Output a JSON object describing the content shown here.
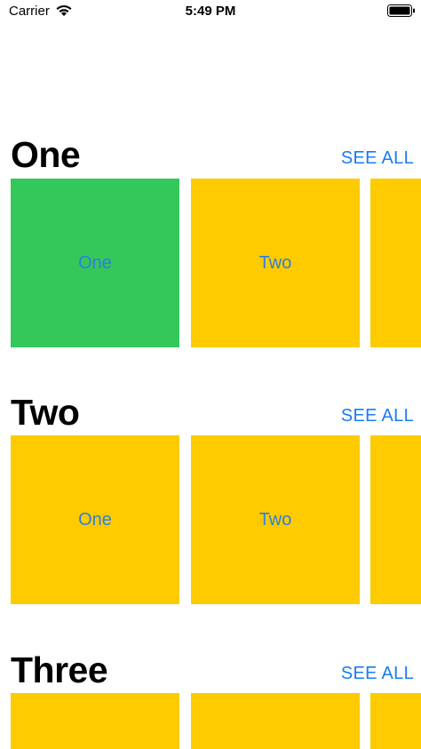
{
  "status_bar": {
    "carrier": "Carrier",
    "time": "5:49 PM",
    "icons": [
      "wifi-icon",
      "battery-icon"
    ]
  },
  "colors": {
    "accent": "#1a7cf0",
    "card_yellow": "#fecb00",
    "card_green": "#34c759",
    "card_label": "#2d7fe0"
  },
  "sections": [
    {
      "title": "One",
      "see_all": "SEE ALL",
      "cards": [
        {
          "label": "One",
          "color": "#34c759"
        },
        {
          "label": "Two",
          "color": "#fecb00"
        },
        {
          "label": "",
          "color": "#fecb00"
        }
      ]
    },
    {
      "title": "Two",
      "see_all": "SEE ALL",
      "cards": [
        {
          "label": "One",
          "color": "#fecb00"
        },
        {
          "label": "Two",
          "color": "#fecb00"
        },
        {
          "label": "",
          "color": "#fecb00"
        }
      ]
    },
    {
      "title": "Three",
      "see_all": "SEE ALL",
      "cards": [
        {
          "label": "",
          "color": "#fecb00"
        },
        {
          "label": "",
          "color": "#fecb00"
        },
        {
          "label": "",
          "color": "#fecb00"
        }
      ]
    }
  ]
}
